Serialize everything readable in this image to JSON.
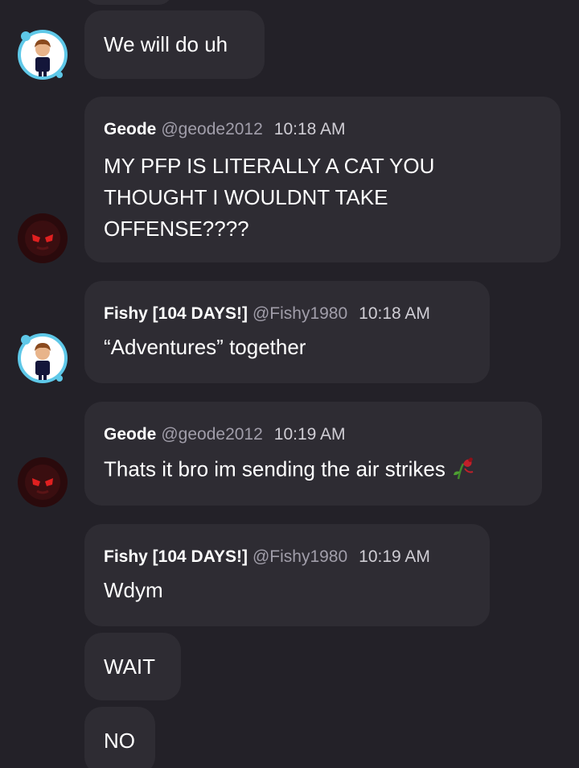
{
  "messages": [
    {
      "header": null,
      "text": "We will do uh"
    },
    {
      "name": "Geode",
      "handle": "@geode2012",
      "time": "10:18 AM",
      "lines": [
        "MY PFP IS LITERALLY A CAT YOU",
        "THOUGHT I WOULDNT TAKE",
        "OFFENSE????"
      ]
    },
    {
      "name": "Fishy [104 DAYS!]",
      "handle": "@Fishy1980",
      "time": "10:18 AM",
      "text": "“Adventures” together"
    },
    {
      "name": "Geode",
      "handle": "@geode2012",
      "time": "10:19 AM",
      "text": "Thats it bro im sending the air strikes",
      "emoji": "wilted-rose-icon"
    },
    {
      "name": "Fishy [104 DAYS!]",
      "handle": "@Fishy1980",
      "time": "10:19 AM",
      "text": "Wdym"
    },
    {
      "text": "WAIT"
    },
    {
      "text": "NO"
    }
  ],
  "colors": {
    "background": "#232128",
    "bubble": "#2e2c33",
    "handle": "#a19eaa",
    "time": "#cfcdd4",
    "geode_avatar": "#2a0a0c",
    "geode_eyes": "#e02020",
    "fishy_ring": "#5ec8e8"
  }
}
